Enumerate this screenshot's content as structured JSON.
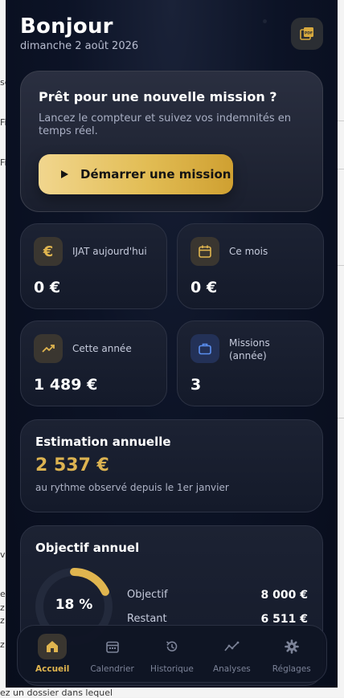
{
  "background": {
    "fragments": [
      "se",
      "Fi",
      "Fi",
      "v",
      "ez",
      "z",
      "z",
      "z",
      "ez un dossier dans lequel"
    ]
  },
  "header": {
    "greeting": "Bonjour",
    "date": "dimanche 2 août 2026",
    "pdf_icon": "pdf-icon"
  },
  "mission_card": {
    "title": "Prêt pour une nouvelle mission ?",
    "subtitle": "Lancez le compteur et suivez vos indemnités en temps réel.",
    "button_label": "Démarrer une mission"
  },
  "stats": [
    {
      "icon": "euro-icon",
      "label": "IJAT aujourd'hui",
      "value": "0 €"
    },
    {
      "icon": "calendar-icon",
      "label": "Ce mois",
      "value": "0 €"
    },
    {
      "icon": "trending-up-icon",
      "label": "Cette année",
      "value": "1 489 €"
    },
    {
      "icon": "briefcase-icon",
      "label": "Missions (année)",
      "value": "3"
    }
  ],
  "estimate": {
    "title": "Estimation annuelle",
    "value": "2 537 €",
    "subtitle": "au rythme observé depuis le 1er janvier"
  },
  "objective": {
    "title": "Objectif annuel",
    "percent_label": "18 %",
    "progress": 0.18,
    "rows": [
      {
        "label": "Objectif",
        "value": "8 000 €"
      },
      {
        "label": "Restant",
        "value": "6 511 €"
      }
    ]
  },
  "tabs": [
    {
      "label": "Accueil",
      "icon": "home-icon",
      "active": true
    },
    {
      "label": "Calendrier",
      "icon": "calendar-icon",
      "active": false
    },
    {
      "label": "Historique",
      "icon": "history-icon",
      "active": false
    },
    {
      "label": "Analyses",
      "icon": "analytics-icon",
      "active": false
    },
    {
      "label": "Réglages",
      "icon": "gear-icon",
      "active": false
    }
  ],
  "colors": {
    "accent_gold": "#dcb351",
    "background_navy": "#0c1326",
    "icon_blue": "#3b6fd8"
  }
}
